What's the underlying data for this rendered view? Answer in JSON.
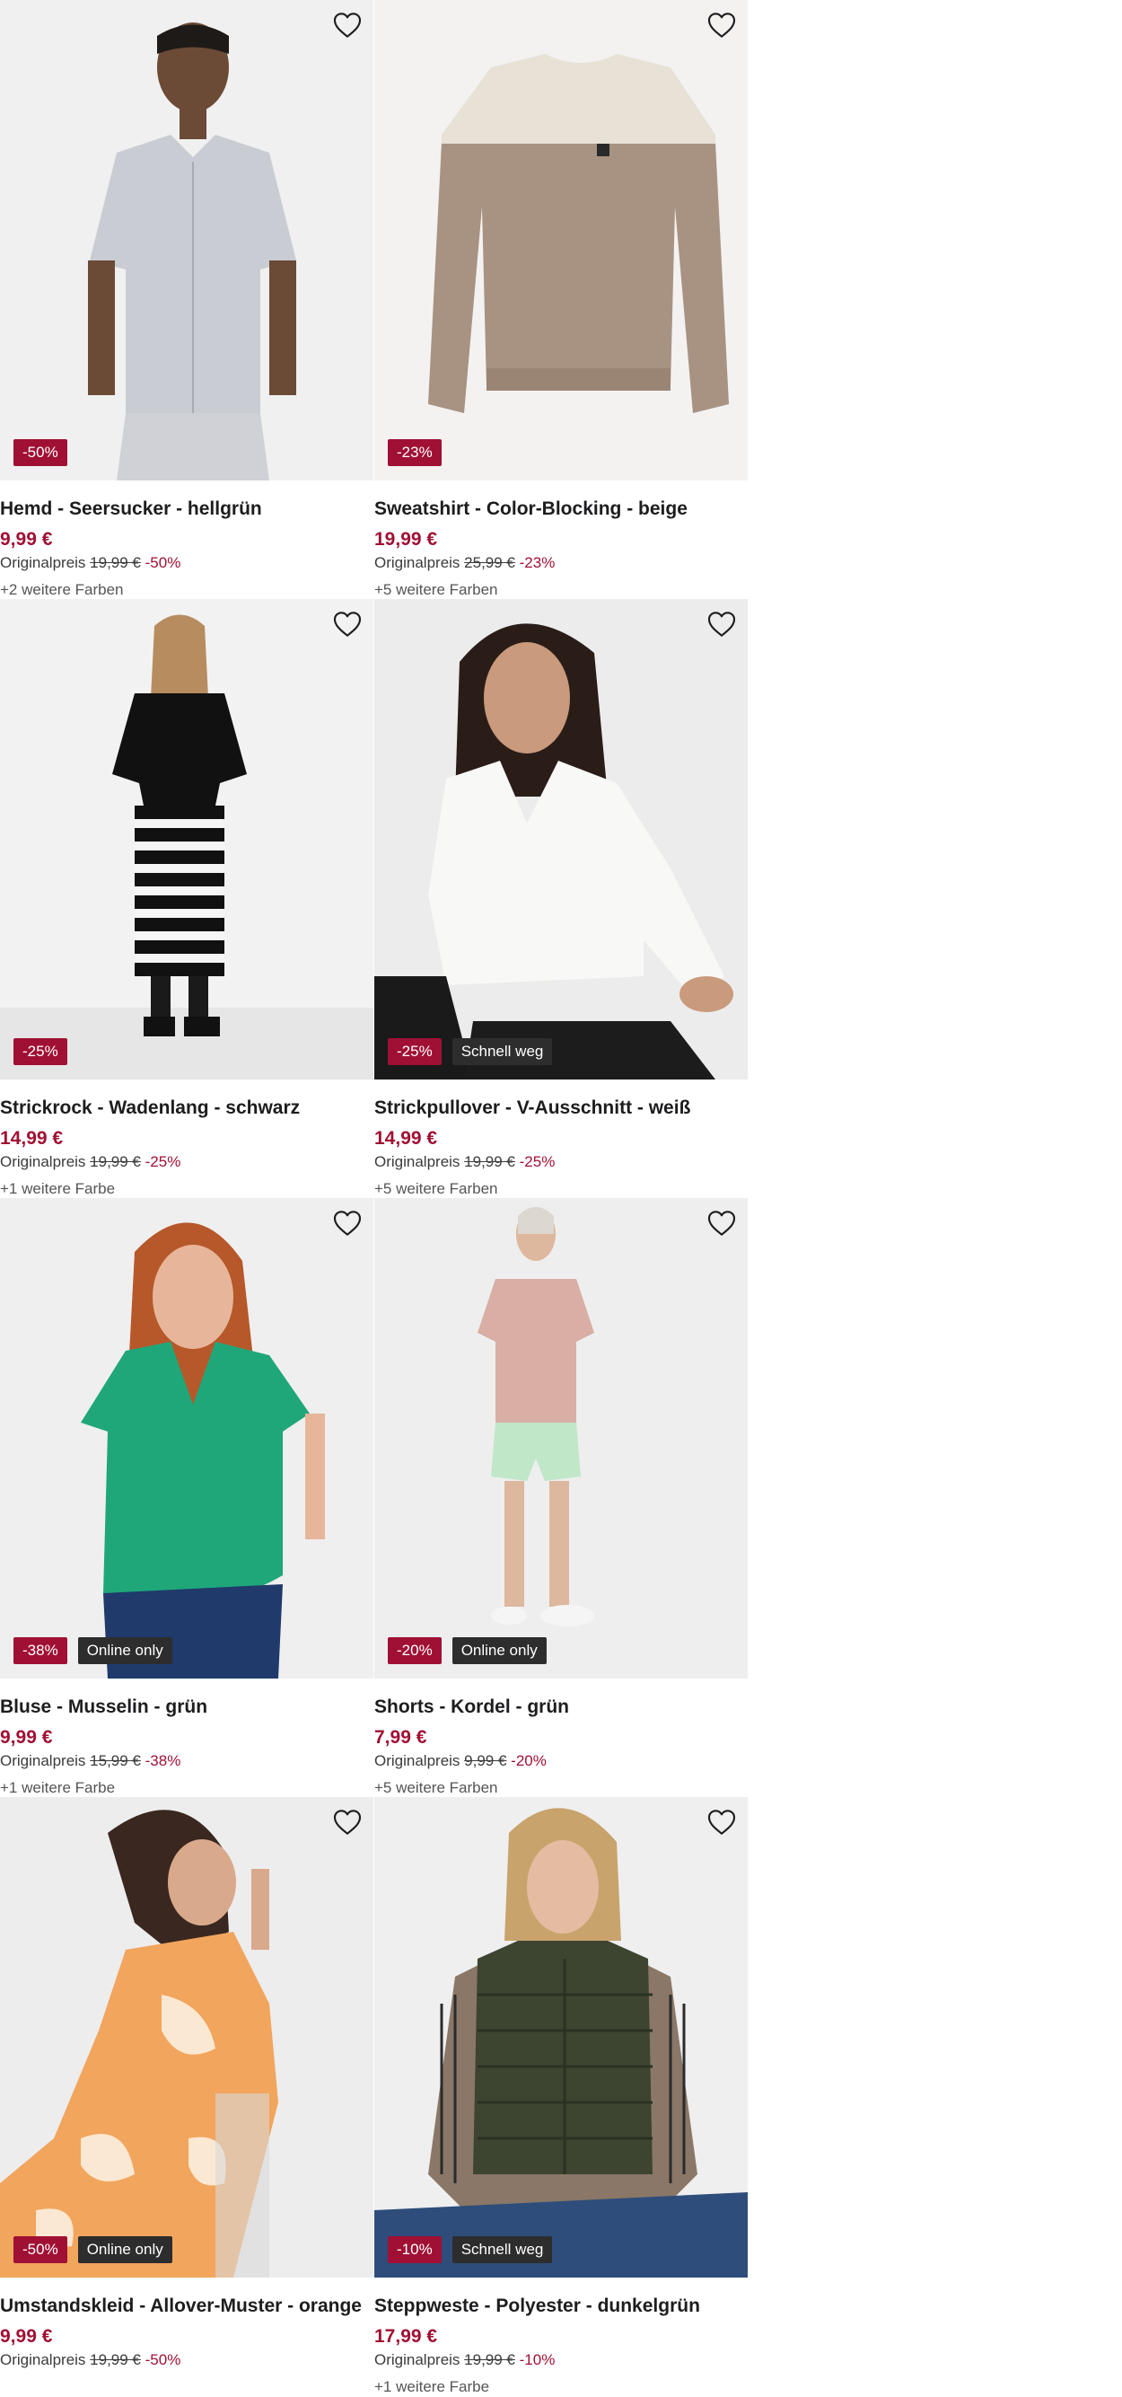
{
  "products": [
    {
      "name": "Hemd - Seersucker - hellgrün",
      "price": "9,99 €",
      "original_label": "Originalpreis",
      "original_price": "19,99 €",
      "discount": "-50%",
      "flag": "",
      "colors": "+2 weitere Farben",
      "image": "man-short-sleeve-shirt",
      "bg": "#efefef"
    },
    {
      "name": "Sweatshirt - Color-Blocking - beige",
      "price": "19,99 €",
      "original_label": "Originalpreis",
      "original_price": "25,99 €",
      "discount": "-23%",
      "flag": "",
      "colors": "+5 weitere Farben",
      "image": "color-block-sweatshirt",
      "bg": "#f3f2f1"
    },
    {
      "name": "Strickrock - Wadenlang - schwarz",
      "price": "14,99 €",
      "original_label": "Originalpreis",
      "original_price": "19,99 €",
      "discount": "-25%",
      "flag": "",
      "colors": "+1 weitere Farbe",
      "image": "woman-striped-skirt",
      "bg": "#f1f1f1"
    },
    {
      "name": "Strickpullover - V-Ausschnitt - weiß",
      "price": "14,99 €",
      "original_label": "Originalpreis",
      "original_price": "19,99 €",
      "discount": "-25%",
      "flag": "Schnell weg",
      "colors": "+5 weitere Farben",
      "image": "woman-white-sweater",
      "bg": "#ececec"
    },
    {
      "name": "Bluse - Musselin - grün",
      "price": "9,99 €",
      "original_label": "Originalpreis",
      "original_price": "15,99 €",
      "discount": "-38%",
      "flag": "Online only",
      "colors": "+1 weitere Farbe",
      "image": "woman-green-blouse",
      "bg": "#efefef"
    },
    {
      "name": "Shorts - Kordel - grün",
      "price": "7,99 €",
      "original_label": "Originalpreis",
      "original_price": "9,99 €",
      "discount": "-20%",
      "flag": "Online only",
      "colors": "+5 weitere Farben",
      "image": "woman-mint-shorts",
      "bg": "#eeeeee"
    },
    {
      "name": "Umstandskleid - Allover-Muster - orange",
      "price": "9,99 €",
      "original_label": "Originalpreis",
      "original_price": "19,99 €",
      "discount": "-50%",
      "flag": "Online only",
      "colors": "",
      "image": "woman-orange-dress",
      "bg": "#ededed"
    },
    {
      "name": "Steppweste - Polyester - dunkelgrün",
      "price": "17,99 €",
      "original_label": "Originalpreis",
      "original_price": "19,99 €",
      "discount": "-10%",
      "flag": "Schnell weg",
      "colors": "+1 weitere Farbe",
      "image": "woman-quilted-vest",
      "bg": "#efefef"
    }
  ],
  "icons": {
    "wishlist": "heart-outline-icon"
  },
  "colors": {
    "accent": "#a01034",
    "flag_bg": "#2d2d2d",
    "text": "#1d1d1f"
  }
}
